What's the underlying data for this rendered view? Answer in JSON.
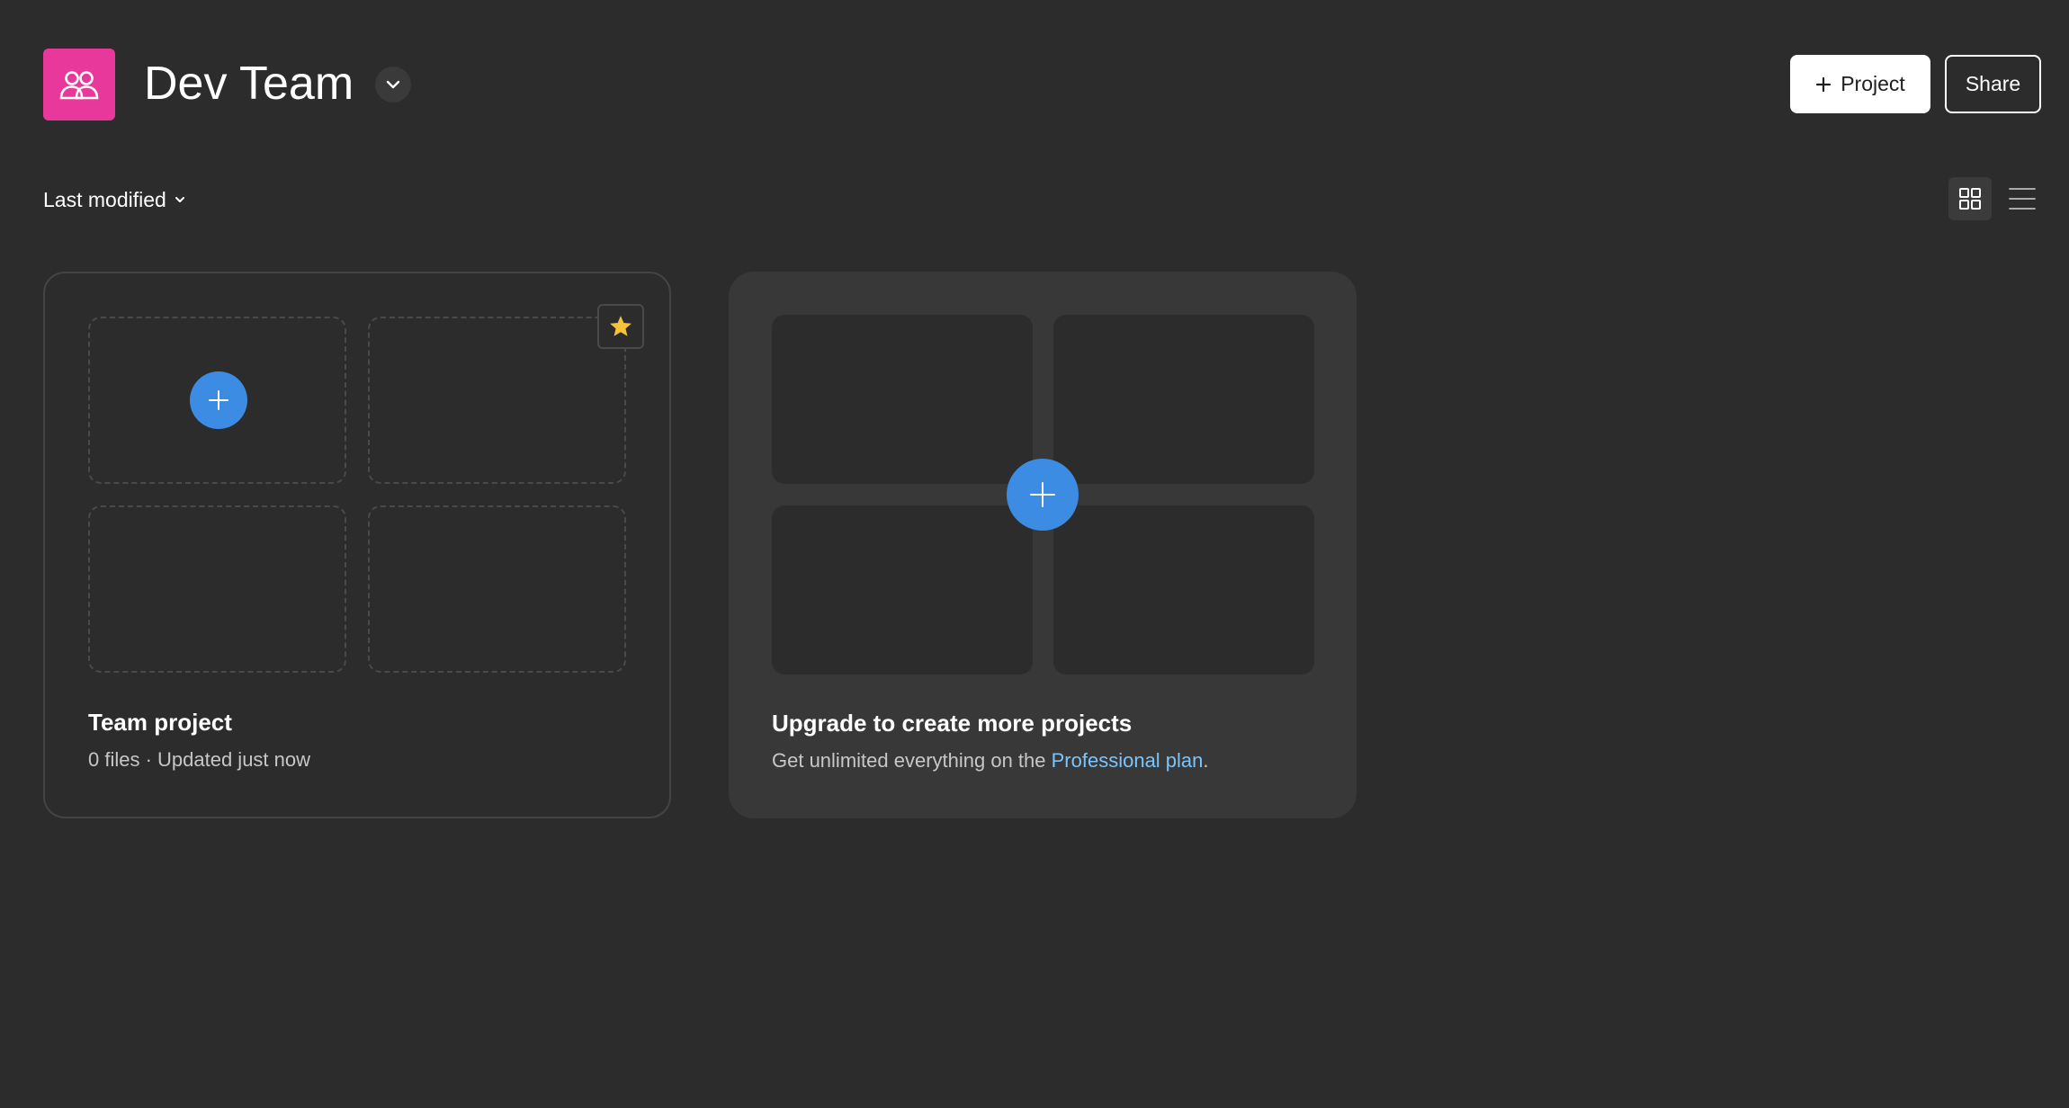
{
  "header": {
    "team_name": "Dev Team",
    "team_logo_icon": "people-icon",
    "team_logo_color": "#e8389c",
    "new_project_label": "Project",
    "share_label": "Share"
  },
  "toolbar": {
    "sort_label": "Last modified",
    "grid_view_icon": "grid-icon",
    "list_view_icon": "list-icon",
    "active_view": "grid"
  },
  "projects": [
    {
      "title": "Team project",
      "meta": "0 files · Updated just now",
      "starred": true
    }
  ],
  "upgrade_card": {
    "title": "Upgrade to create more projects",
    "text_before": "Get unlimited everything on the ",
    "link_text": "Professional plan",
    "text_after": "."
  },
  "colors": {
    "background": "#2c2c2c",
    "accent_blue": "#3d8ce3",
    "link": "#7cc4fa",
    "star": "#f3c338"
  }
}
